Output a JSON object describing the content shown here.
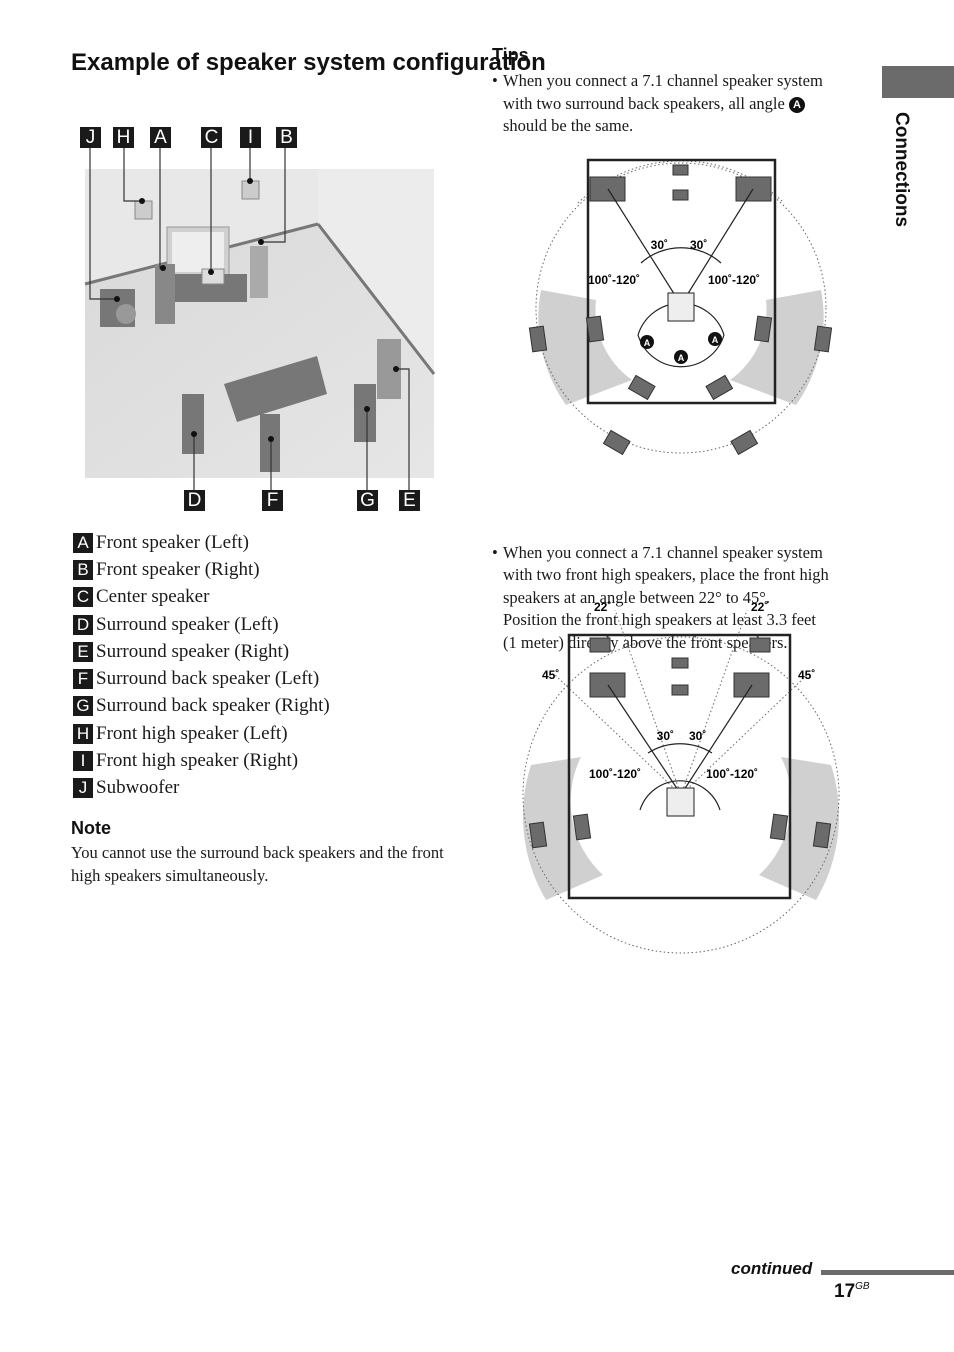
{
  "page": {
    "title": "Example of speaker system configuration",
    "side_tab": "Connections",
    "continued": "continued",
    "page_number": "17",
    "page_suffix": "GB"
  },
  "illustration": {
    "callouts_top": [
      "J",
      "H",
      "A",
      "C",
      "I",
      "B"
    ],
    "callouts_bottom": [
      "D",
      "F",
      "G",
      "E"
    ]
  },
  "legend": [
    {
      "key": "A",
      "label": "Front speaker (Left)"
    },
    {
      "key": "B",
      "label": "Front speaker (Right)"
    },
    {
      "key": "C",
      "label": "Center speaker"
    },
    {
      "key": "D",
      "label": "Surround speaker (Left)"
    },
    {
      "key": "E",
      "label": "Surround speaker (Right)"
    },
    {
      "key": "F",
      "label": "Surround back speaker (Left)"
    },
    {
      "key": "G",
      "label": "Surround back speaker (Right)"
    },
    {
      "key": "H",
      "label": "Front high speaker (Left)"
    },
    {
      "key": "I",
      "label": "Front high speaker (Right)"
    },
    {
      "key": "J",
      "label": "Subwoofer"
    }
  ],
  "note": {
    "heading": "Note",
    "text": "You cannot use the surround back speakers and the front high speakers simultaneously."
  },
  "tips": {
    "heading": "Tips",
    "bullet": "•",
    "tip1": {
      "line1": "When you connect a 7.1 channel speaker system",
      "line2_pre": "with two surround back speakers, all angle",
      "angle_marker": "A",
      "line3": "should be the same."
    },
    "tip2": {
      "lines": [
        "When you connect a 7.1 channel speaker system",
        "with two front high speakers, place the front high",
        "speakers at an angle between 22° to 45°.",
        "Position the front high speakers at least 3.3 feet",
        "(1 meter) directly above the front speakers."
      ]
    }
  },
  "diagram1": {
    "angle_front_left": "30˚",
    "angle_front_right": "30˚",
    "angle_surround_left": "100˚-120˚",
    "angle_surround_right": "100˚-120˚",
    "angle_marker": "A"
  },
  "diagram2": {
    "angle_high_left_min": "22˚",
    "angle_high_right_min": "22˚",
    "angle_high_left_max": "45˚",
    "angle_high_right_max": "45˚",
    "angle_front_left": "30˚",
    "angle_front_right": "30˚",
    "angle_surround_left": "100˚-120˚",
    "angle_surround_right": "100˚-120˚"
  }
}
